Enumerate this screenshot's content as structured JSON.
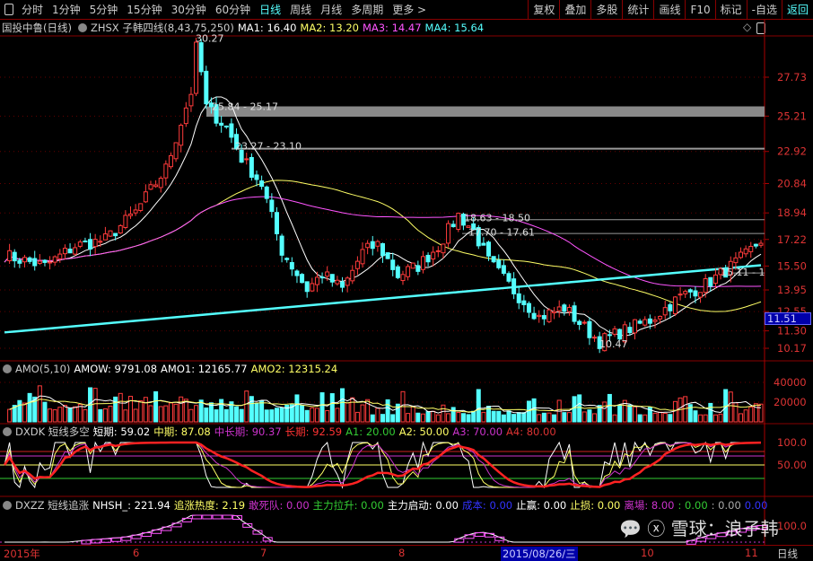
{
  "toolbar": {
    "periods": [
      "分时",
      "1分钟",
      "5分钟",
      "15分钟",
      "30分钟",
      "60分钟",
      "日线",
      "周线",
      "月线",
      "多周期",
      "更多 >"
    ],
    "active": "日线",
    "actions": [
      "复权",
      "叠加",
      "多股",
      "统计",
      "画线",
      "F10",
      "标记",
      "-自选",
      "返回"
    ]
  },
  "main": {
    "title": "国投中鲁(日线)",
    "indicator": "ZHSX 子韩四线(8,43,75,250)",
    "ma1": "MA1: 16.40",
    "ma2": "MA2: 13.20",
    "ma3": "MA3: 14.47",
    "ma4": "MA4: 15.64",
    "price_ticks": [
      "27.73",
      "25.21",
      "22.92",
      "20.84",
      "18.94",
      "17.22",
      "15.50",
      "13.95",
      "12.55",
      "11.30",
      "10.17"
    ],
    "price_tick_values": [
      27.73,
      25.21,
      22.92,
      20.84,
      18.94,
      17.22,
      15.5,
      13.95,
      12.55,
      11.3,
      10.17
    ],
    "last_price": "11.51",
    "annotations": [
      "30.27",
      "25.84 - 25.17",
      "23.27 - 23.10",
      "18.63 - 18.50",
      "17.70 - 17.61",
      "10.47",
      "15.11 - 1"
    ],
    "price_path": [
      [
        0,
        16.2
      ],
      [
        8,
        15.5
      ],
      [
        14,
        16.8
      ],
      [
        20,
        17.2
      ],
      [
        26,
        19.0
      ],
      [
        32,
        21.8
      ],
      [
        37,
        26.8
      ],
      [
        38,
        30.27
      ],
      [
        40,
        25.8
      ],
      [
        44,
        24.5
      ],
      [
        47,
        22.5
      ],
      [
        51,
        20.8
      ],
      [
        55,
        16.5
      ],
      [
        60,
        14.0
      ],
      [
        63,
        15.0
      ],
      [
        67,
        14.0
      ],
      [
        71,
        16.4
      ],
      [
        74,
        16.9
      ],
      [
        78,
        14.9
      ],
      [
        82,
        15.5
      ],
      [
        86,
        16.8
      ],
      [
        90,
        18.8
      ],
      [
        93,
        17.8
      ],
      [
        96,
        15.8
      ],
      [
        101,
        13.9
      ],
      [
        106,
        12.2
      ],
      [
        111,
        12.8
      ],
      [
        115,
        11.5
      ],
      [
        118,
        10.6
      ],
      [
        122,
        11.2
      ],
      [
        128,
        12.0
      ],
      [
        134,
        13.5
      ],
      [
        139,
        14.3
      ],
      [
        143,
        15.2
      ],
      [
        147,
        16.2
      ],
      [
        150,
        17.2
      ]
    ],
    "colors": {
      "up": "#ff3b3b",
      "down": "#54ffff",
      "ma1": "#ffffff",
      "ma2": "#ffff66",
      "ma3": "#ff55ff",
      "ma4": "#54ffff"
    }
  },
  "amo": {
    "title": "AMO(5,10)",
    "amow": "AMOW: 9791.08",
    "amo1": "AMO1: 12165.77",
    "amo2": "AMO2: 12315.24",
    "ticks": [
      "40000",
      "20000"
    ]
  },
  "dxdk": {
    "title": "DXDK 短线多空",
    "short": "短期: 59.02",
    "mid": "中期: 87.08",
    "midlong": "中长期: 90.37",
    "long": "长期: 92.59",
    "a1": "A1: 20.00",
    "a2": "A2: 50.00",
    "a3": "A3: 70.00",
    "a4": "A4: 80.00",
    "ticks": [
      "100.0",
      "50.00"
    ]
  },
  "dxzz": {
    "title": "DXZZ 短线追涨",
    "nhsh": "NHSH_: 221.94",
    "heat": "追涨热度: 2.19",
    "dare": "敢死队: 0.00",
    "pull": "主力拉升: 0.00",
    "start": "主力启动: 0.00",
    "cost": "成本: 0.00",
    "tp": "止赢: 0.00",
    "sl": "止损: 0.00",
    "exit": "离場: 8.00",
    "v1": ": 0.00",
    "v2": ": 0.00",
    "v3": "0.00",
    "tick": "100.0"
  },
  "dates": {
    "labels": [
      "2015年",
      "6",
      "7",
      "8",
      "10",
      "11"
    ],
    "selected": "2015/08/26/三",
    "period": "日线"
  },
  "watermark": "雪球：浪子韩"
}
